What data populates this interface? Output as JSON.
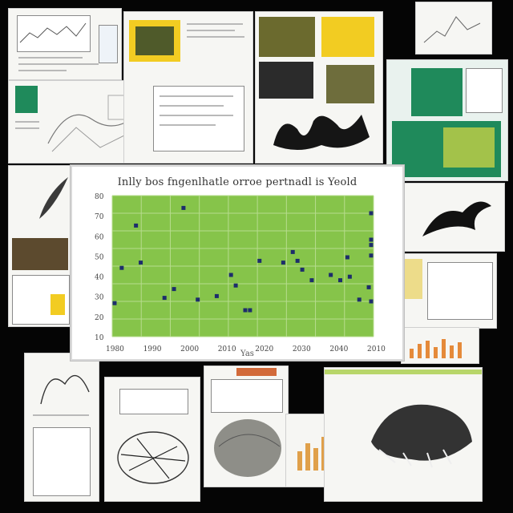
{
  "collage": {
    "panels": [
      {
        "name": "panel-top-left-document"
      },
      {
        "name": "panel-top-centre-document"
      },
      {
        "name": "panel-top-right-images"
      },
      {
        "name": "panel-right-green-slides"
      },
      {
        "name": "panel-left-stacked-pages"
      },
      {
        "name": "panel-bottom-documents"
      }
    ],
    "colors": {
      "background": "#050505",
      "plot_fill": "#86c44a",
      "point": "#1d2d6b",
      "accent_green": "#1f8a5b"
    }
  },
  "chart_data": {
    "type": "scatter",
    "title": "Inlly bos fngenlhatle orroe pertnadl is Yeold",
    "ylabel": "",
    "xlabel": "Yas",
    "xlim": [
      1990,
      2045
    ],
    "ylim": [
      0,
      80
    ],
    "xticks": [
      "1980",
      "1990",
      "2000",
      "2010",
      "2020",
      "2030",
      "2040",
      "2010"
    ],
    "yticks": [
      "80",
      "70",
      "60",
      "50",
      "40",
      "30",
      "20",
      "10"
    ],
    "grid": true,
    "points": [
      {
        "x": 1990.5,
        "y": 19
      },
      {
        "x": 1995,
        "y": 63
      },
      {
        "x": 1992,
        "y": 39
      },
      {
        "x": 1996,
        "y": 42
      },
      {
        "x": 2001,
        "y": 22
      },
      {
        "x": 2003,
        "y": 27
      },
      {
        "x": 2005,
        "y": 73
      },
      {
        "x": 2008,
        "y": 21
      },
      {
        "x": 2012,
        "y": 23
      },
      {
        "x": 2015,
        "y": 35
      },
      {
        "x": 2016,
        "y": 29
      },
      {
        "x": 2018,
        "y": 15
      },
      {
        "x": 2019,
        "y": 15
      },
      {
        "x": 2021,
        "y": 43
      },
      {
        "x": 2026,
        "y": 42
      },
      {
        "x": 2028,
        "y": 48
      },
      {
        "x": 2029,
        "y": 43
      },
      {
        "x": 2030,
        "y": 38
      },
      {
        "x": 2032,
        "y": 32
      },
      {
        "x": 2036,
        "y": 35
      },
      {
        "x": 2038,
        "y": 32
      },
      {
        "x": 2039.5,
        "y": 45
      },
      {
        "x": 2040,
        "y": 34
      },
      {
        "x": 2042,
        "y": 21
      },
      {
        "x": 2044,
        "y": 28
      },
      {
        "x": 2046,
        "y": 52
      },
      {
        "x": 2048,
        "y": 55
      },
      {
        "x": 2047,
        "y": 20
      },
      {
        "x": 2044.5,
        "y": 70
      },
      {
        "x": 2046.5,
        "y": 46
      }
    ]
  }
}
